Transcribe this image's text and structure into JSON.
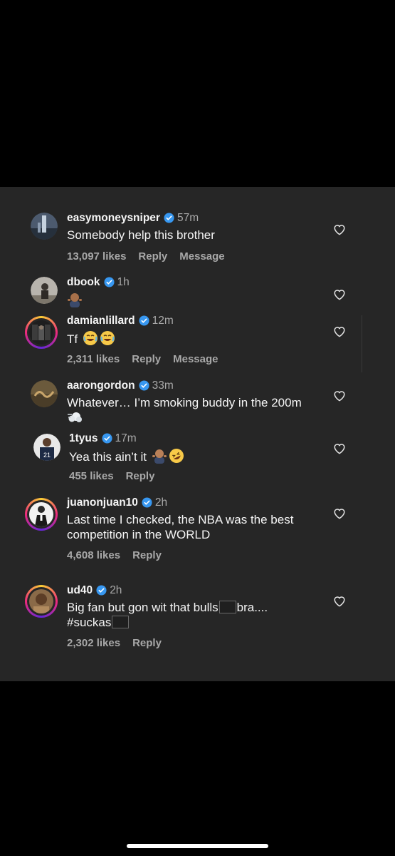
{
  "comments": [
    {
      "username": "easymoneysniper",
      "time": "57m",
      "text": "Somebody help this brother",
      "likes": "13,097 likes",
      "reply": "Reply",
      "message": "Message"
    },
    {
      "username": "dbook",
      "time": "1h",
      "emoji_name": "person-shrugging-emoji"
    },
    {
      "username": "damianlillard",
      "time": "12m",
      "text": "Tf",
      "emoji_names": [
        "joy-emoji",
        "joy-emoji"
      ],
      "likes": "2,311 likes",
      "reply": "Reply",
      "message": "Message"
    },
    {
      "username": "aarongordon",
      "time": "33m",
      "text": "Whatever… I’m smoking buddy in the 200m",
      "emoji_name": "dash-emoji"
    },
    {
      "username": "1tyus",
      "time": "17m",
      "text": "Yea this ain’t it",
      "emoji_names": [
        "person-shrugging-emoji",
        "rolling-laughing-emoji"
      ],
      "likes": "455 likes",
      "reply": "Reply"
    },
    {
      "username": "juanonjuan10",
      "time": "2h",
      "text": "Last time I checked, the NBA was the best competition in the WORLD",
      "likes": "4,608 likes",
      "reply": "Reply"
    },
    {
      "username": "ud40",
      "time": "2h",
      "text_part1": "Big fan but gon wit that bulls",
      "text_part2": "bra....",
      "text_part3": "#suckas",
      "likes": "2,302 likes",
      "reply": "Reply"
    }
  ],
  "colors": {
    "panel": "#262626",
    "text": "#f5f5f5",
    "secondary": "#a8a8a8",
    "verified": "#3797f0"
  },
  "icons": {
    "verified": "verified-badge-icon",
    "like": "heart-outline-icon"
  }
}
